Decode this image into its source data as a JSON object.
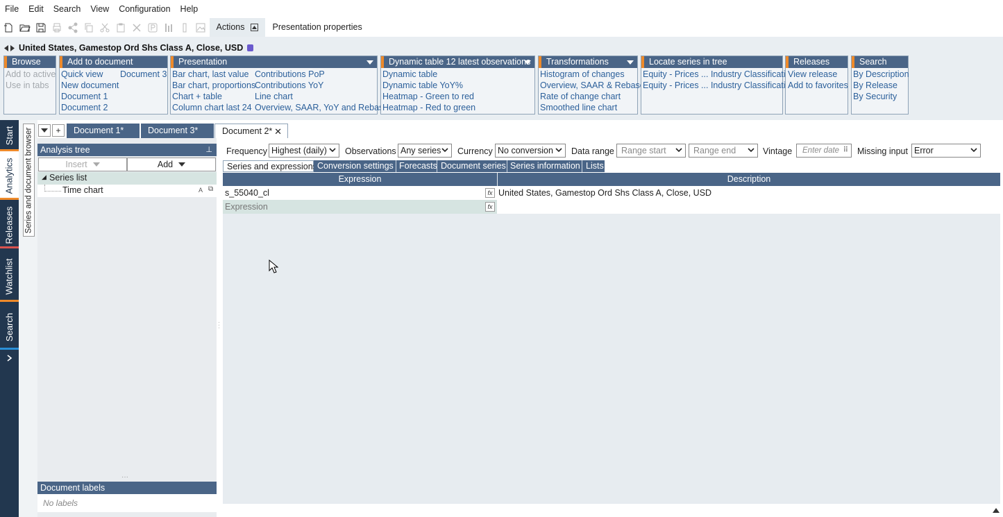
{
  "menu": [
    "File",
    "Edit",
    "Search",
    "View",
    "Configuration",
    "Help"
  ],
  "toolbar": {
    "icons": [
      "new-document-icon",
      "open-folder-icon",
      "save-icon",
      "print-icon",
      "share-icon",
      "copy-icon",
      "cut-icon",
      "paste-icon",
      "delete-icon",
      "presentation-icon",
      "chart-icon",
      "column-icon",
      "image-icon"
    ],
    "actions_tab": "Actions",
    "presentation_properties_tab": "Presentation properties"
  },
  "series_header": {
    "title": "United States, Gamestop Ord Shs Class A, Close, USD",
    "info_icon": "info-icon"
  },
  "ribbon": {
    "browse": {
      "title": "Browse",
      "items": [
        "Add to active",
        "Use in tabs"
      ]
    },
    "add_to_document": {
      "title": "Add to document",
      "col1": [
        "Quick view",
        "New document",
        "Document 1",
        "Document 2"
      ],
      "col2": [
        "Document 3"
      ]
    },
    "presentation": {
      "title": "Presentation",
      "col1": [
        "Bar chart, last value",
        "Bar chart, proportions",
        "Chart + table",
        "Column chart last 24"
      ],
      "col2": [
        "Contributions PoP",
        "Contributions YoY",
        "Line chart",
        "Overview, SAAR, YoY and Rebase"
      ]
    },
    "dynamic_table": {
      "title": "Dynamic table 12 latest observations",
      "items": [
        "Dynamic table",
        "Dynamic table YoY%",
        "Heatmap - Green to red",
        "Heatmap - Red to green"
      ]
    },
    "transformations": {
      "title": "Transformations",
      "items": [
        "Histogram of changes",
        "Overview, SAAR & Rebase",
        "Rate of change chart",
        "Smoothed line chart"
      ]
    },
    "locate": {
      "title": "Locate series in tree",
      "items": [
        "Equity - Prices ... Industry Classificati...",
        "Equity - Prices ... Industry Classificati..."
      ]
    },
    "releases": {
      "title": "Releases",
      "items": [
        "View release",
        "Add to favorites"
      ]
    },
    "search": {
      "title": "Search",
      "items": [
        "By Description",
        "By Release",
        "By Security"
      ]
    }
  },
  "sidebar": {
    "tabs": [
      "Start",
      "Analytics",
      "Releases",
      "Watchlist",
      "Search"
    ],
    "expand_icon": "chevron-right-icon"
  },
  "doc_browser_tab": "Series and document browser",
  "doc_tabs": [
    "Document 1*",
    "Document 3*",
    "Document 2*"
  ],
  "analysis_tree": {
    "title": "Analysis tree",
    "insert_label": "Insert",
    "add_label": "Add",
    "root": "Series list",
    "child": "Time chart",
    "child_badge": "A"
  },
  "doc_labels": {
    "title": "Document labels",
    "empty": "No labels"
  },
  "settings": {
    "frequency_label": "Frequency",
    "frequency_value": "Highest (daily)",
    "observations_label": "Observations",
    "observations_value": "Any series",
    "currency_label": "Currency",
    "currency_value": "No conversion",
    "data_range_label": "Data range",
    "range_start": "Range start",
    "range_end": "Range end",
    "vintage_label": "Vintage",
    "vintage_placeholder": "Enter date",
    "missing_label": "Missing input",
    "missing_value": "Error"
  },
  "sub_tabs": [
    "Series and expressions",
    "Conversion settings",
    "Forecasts",
    "Document series",
    "Series information",
    "Lists"
  ],
  "grid": {
    "columns": [
      "Expression",
      "Description"
    ],
    "rows": [
      {
        "expression": "s_55040_cl",
        "description": "United States, Gamestop Ord Shs Class A, Close, USD"
      }
    ],
    "new_row_placeholder": "Expression",
    "fx_label": "fx"
  },
  "colors": {
    "header": "#4a6587",
    "accent": "#ee8a2a",
    "sidebar": "#22374f",
    "link": "#2b5f9a"
  }
}
